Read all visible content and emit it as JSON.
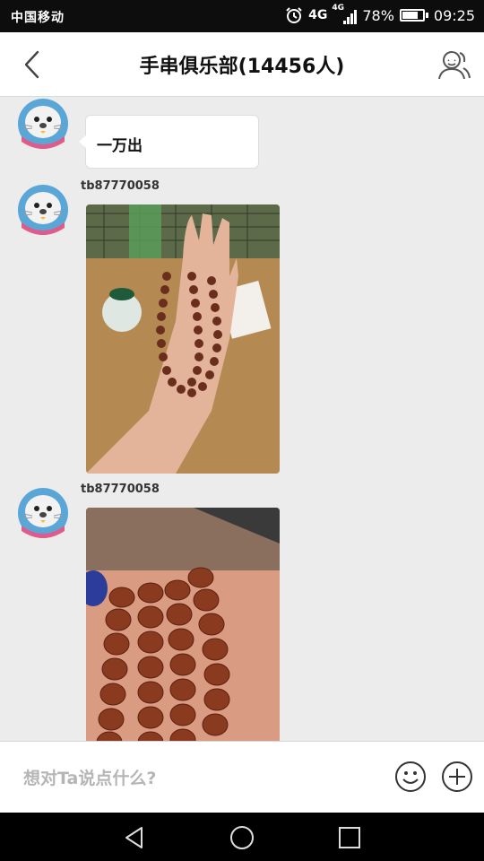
{
  "status_bar": {
    "carrier": "中国移动",
    "network_1": "4G",
    "network_2": "4G",
    "battery_percent": "78%",
    "battery_level": 0.78,
    "time": "09:25",
    "icons": [
      "alarm-icon",
      "signal-icon",
      "battery-icon"
    ]
  },
  "header": {
    "title": "手串俱乐部(14456人)",
    "back_icon": "chevron-left-icon",
    "members_icon": "group-members-icon"
  },
  "messages": [
    {
      "sender": "tb87770058",
      "type": "text",
      "text": "一万出"
    },
    {
      "sender": "tb87770058",
      "type": "image",
      "image": "hand-holding-bodhi-bead-necklace-photo"
    },
    {
      "sender": "tb87770058",
      "type": "image",
      "image": "bodhi-bead-bracelets-closeup-photo"
    }
  ],
  "input_bar": {
    "placeholder": "想对Ta说点什么?",
    "emoji_icon": "smiley-icon",
    "add_icon": "plus-circle-icon"
  },
  "system_nav": {
    "icons": [
      "back-triangle-icon",
      "home-circle-icon",
      "recents-square-icon"
    ]
  },
  "colors": {
    "chat_background": "#ececec",
    "status_bar": "#0d0d0d",
    "bubble": "#ffffff",
    "placeholder": "#b5b5b5"
  }
}
